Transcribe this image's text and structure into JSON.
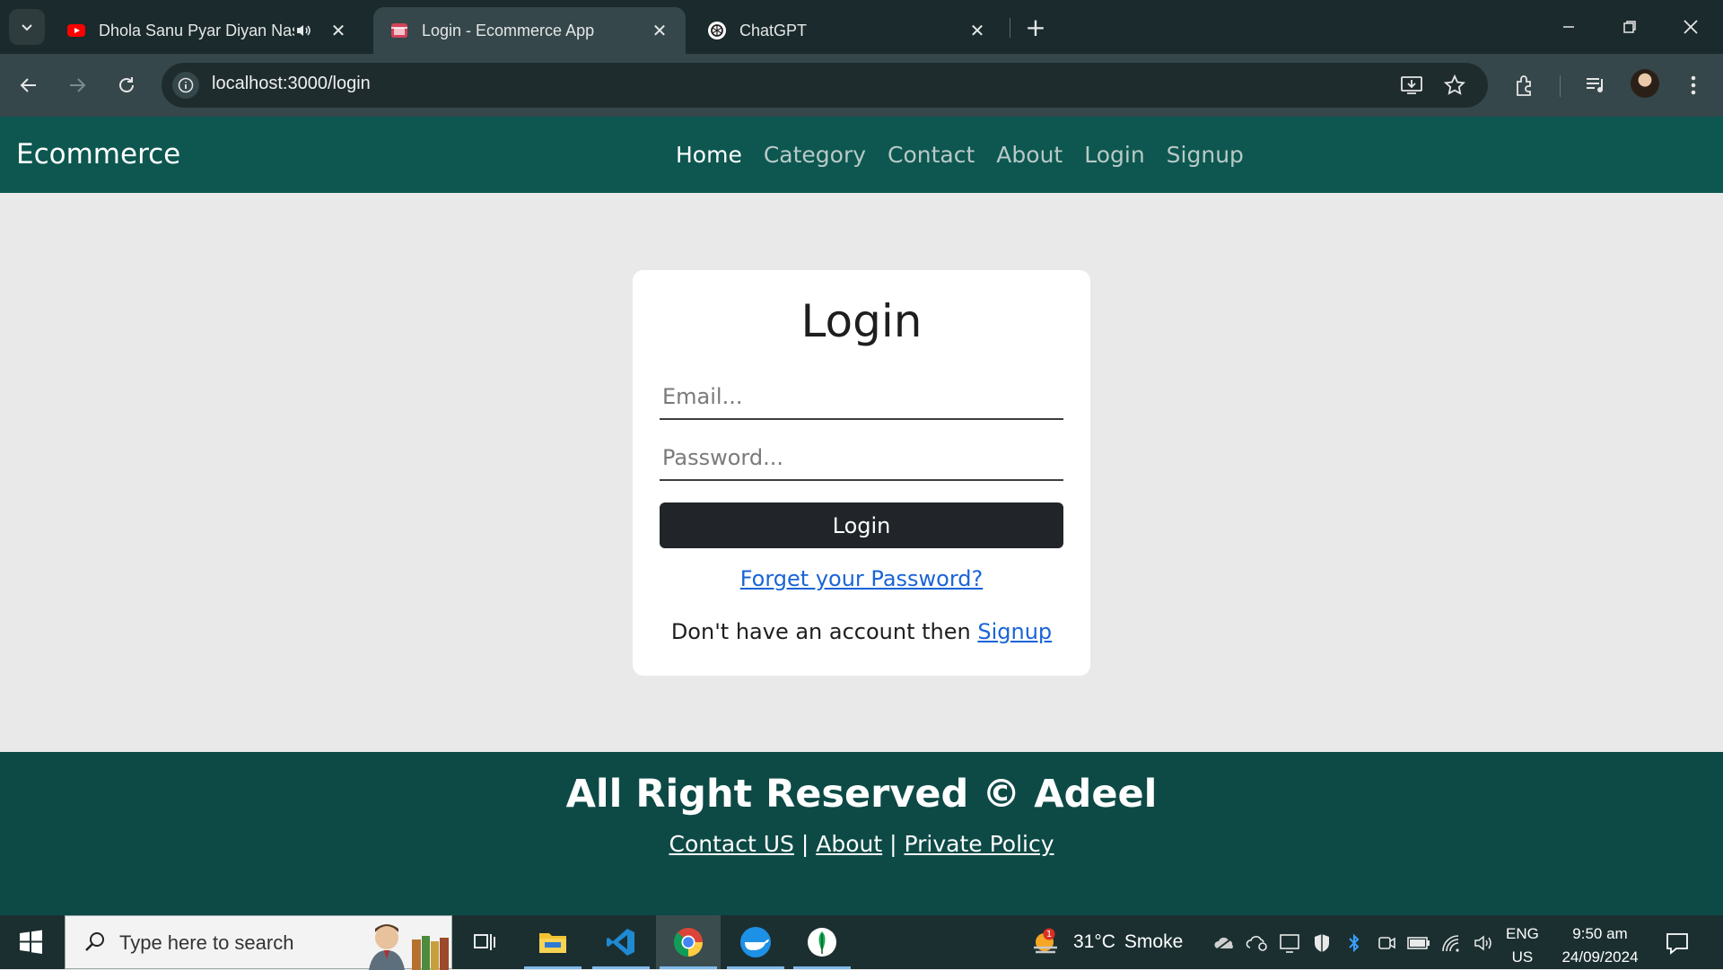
{
  "browser": {
    "tabs": [
      {
        "title": "Dhola Sanu Pyar Diyan Nashi",
        "favicon": "youtube-icon",
        "playing_audio": true,
        "active": false
      },
      {
        "title": "Login - Ecommerce App",
        "favicon": "store-icon",
        "playing_audio": false,
        "active": true
      },
      {
        "title": "ChatGPT",
        "favicon": "chatgpt-icon",
        "playing_audio": false,
        "active": false
      }
    ],
    "url": "localhost:3000/login"
  },
  "app": {
    "brand": "Ecommerce",
    "nav": [
      {
        "label": "Home",
        "active": true
      },
      {
        "label": "Category",
        "active": false
      },
      {
        "label": "Contact",
        "active": false
      },
      {
        "label": "About",
        "active": false
      },
      {
        "label": "Login",
        "active": false
      },
      {
        "label": "Signup",
        "active": false
      }
    ],
    "colors": {
      "nav_bg": "#0d5750",
      "footer_bg": "#0d4a46",
      "button_bg": "#212529",
      "link": "#1a64d6"
    }
  },
  "login": {
    "title": "Login",
    "email_placeholder": "Email...",
    "password_placeholder": "Password...",
    "button": "Login",
    "forgot": "Forget your Password?",
    "signup_prompt": "Don't have an account then",
    "signup_link": "Signup"
  },
  "footer": {
    "title": "All Right Reserved © Adeel",
    "links": [
      "Contact US",
      "About",
      "Private Policy"
    ],
    "separator": "|"
  },
  "taskbar": {
    "search_placeholder": "Type here to search",
    "weather": {
      "temp": "31°C",
      "condition": "Smoke",
      "badge": "1"
    },
    "lang": {
      "line1": "ENG",
      "line2": "US"
    },
    "time": "9:50 am",
    "date": "24/09/2024"
  }
}
